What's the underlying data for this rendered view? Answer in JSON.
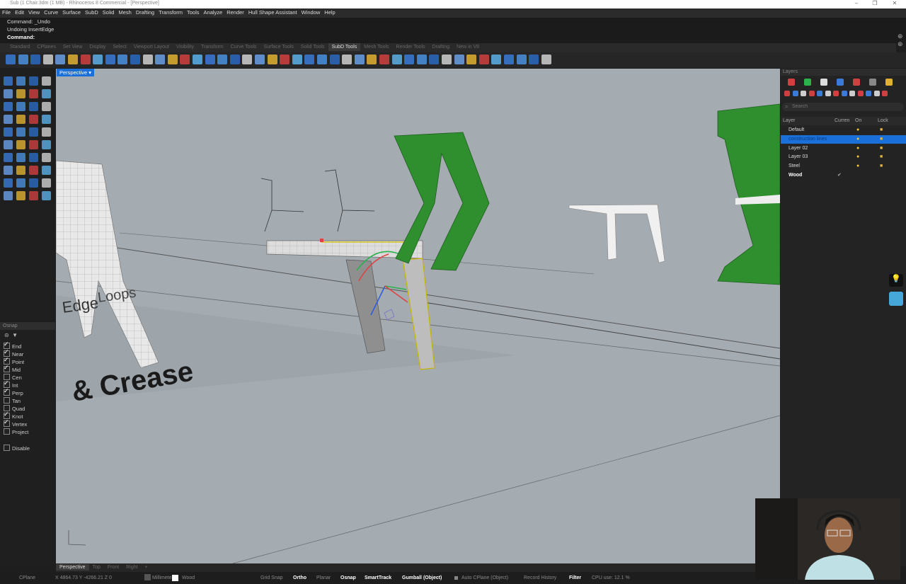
{
  "window": {
    "title": "Sub (1 Chair.3dm (1 MB) - Rhinoceros 8 Commercial - [Perspective]",
    "controls": [
      "–",
      "❐",
      "✕"
    ]
  },
  "menu": [
    "File",
    "Edit",
    "View",
    "Curve",
    "Surface",
    "SubD",
    "Solid",
    "Mesh",
    "Drafting",
    "Transform",
    "Tools",
    "Analyze",
    "Render",
    "Hull Shape Assistant",
    "Window",
    "Help"
  ],
  "command": {
    "history": [
      "Command: _Undo",
      "Undoing InsertEdge"
    ],
    "prompt": "Command:"
  },
  "toolbar_tabs": [
    {
      "label": "Standard",
      "active": false
    },
    {
      "label": "CPlanes",
      "active": false
    },
    {
      "label": "Set View",
      "active": false
    },
    {
      "label": "Display",
      "active": false
    },
    {
      "label": "Select",
      "active": false
    },
    {
      "label": "Viewport Layout",
      "active": false
    },
    {
      "label": "Visibility",
      "active": false
    },
    {
      "label": "Transform",
      "active": false
    },
    {
      "label": "Curve Tools",
      "active": false
    },
    {
      "label": "Surface Tools",
      "active": false
    },
    {
      "label": "Solid Tools",
      "active": false
    },
    {
      "label": "SubD Tools",
      "active": true
    },
    {
      "label": "Mesh Tools",
      "active": false
    },
    {
      "label": "Render Tools",
      "active": false
    },
    {
      "label": "Drafting",
      "active": false
    },
    {
      "label": "New in V8",
      "active": false
    }
  ],
  "viewport": {
    "label": "Perspective",
    "scene_text_1": "& Crease",
    "scene_text_2": "Edge",
    "scene_text_3": "Loops"
  },
  "view_tabs": [
    {
      "label": "Perspective",
      "active": true
    },
    {
      "label": "Top",
      "active": false
    },
    {
      "label": "Front",
      "active": false
    },
    {
      "label": "Right",
      "active": false
    },
    {
      "label": "+",
      "active": false
    }
  ],
  "osnap": {
    "title": "Osnap",
    "items": [
      {
        "label": "End",
        "checked": true
      },
      {
        "label": "Near",
        "checked": true
      },
      {
        "label": "Point",
        "checked": true
      },
      {
        "label": "Mid",
        "checked": true
      },
      {
        "label": "Cen",
        "checked": false
      },
      {
        "label": "Int",
        "checked": true
      },
      {
        "label": "Perp",
        "checked": true
      },
      {
        "label": "Tan",
        "checked": false
      },
      {
        "label": "Quad",
        "checked": false
      },
      {
        "label": "Knot",
        "checked": true
      },
      {
        "label": "Vertex",
        "checked": true
      },
      {
        "label": "Project",
        "checked": false
      }
    ],
    "disable_label": "Disable"
  },
  "layers": {
    "title": "Layers",
    "search_placeholder": "Search",
    "columns": [
      "Layer",
      "Curren",
      "On",
      "Lock"
    ],
    "rows": [
      {
        "name": "Default",
        "color": "#ffffff",
        "selected": false,
        "current": false
      },
      {
        "name": "construction lines",
        "color": "#2aa6ff",
        "selected": true,
        "current": false
      },
      {
        "name": "Layer 02",
        "color": "#ffffff",
        "selected": false,
        "current": false
      },
      {
        "name": "Layer 03",
        "color": "#ffffff",
        "selected": false,
        "current": false
      },
      {
        "name": "Steel",
        "color": "#ffffff",
        "selected": false,
        "current": false
      },
      {
        "name": "Wood",
        "color": "#ffffff",
        "selected": false,
        "current": true
      }
    ]
  },
  "status": {
    "cplane": "CPlane",
    "coords": "X 4864.73 Y -4266.21 Z 0",
    "units": "Millimeters",
    "layer": "Wood",
    "grid_snap": "Grid Snap",
    "ortho": "Ortho",
    "planar": "Planar",
    "osnap": "Osnap",
    "smarttrack": "SmartTrack",
    "gumball": "Gumball (Object)",
    "auto_cplane": "Auto CPlane (Object)",
    "record_history": "Record History",
    "filter": "Filter",
    "cpu": "CPU use: 12.1 %"
  },
  "colors": {
    "accent": "#1a6fd8",
    "chair_green": "#2f8f2f",
    "viewport_bg": "#a4abb1"
  }
}
